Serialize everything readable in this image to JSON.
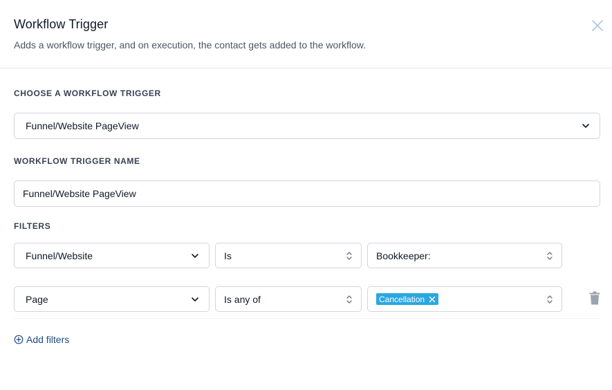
{
  "modal": {
    "title": "Workflow Trigger",
    "subtitle": "Adds a workflow trigger, and on execution, the contact gets added to the workflow.",
    "close_icon": "close-icon"
  },
  "trigger": {
    "label": "CHOOSE A WORKFLOW TRIGGER",
    "selected": "Funnel/Website PageView"
  },
  "trigger_name": {
    "label": "WORKFLOW TRIGGER NAME",
    "value": "Funnel/Website PageView"
  },
  "filters": {
    "label": "FILTERS",
    "rows": [
      {
        "field": "Funnel/Website",
        "operator": "Is",
        "value": "Bookkeeper:"
      },
      {
        "field": "Page",
        "operator": "Is any of",
        "tags": [
          "Cancellation"
        ]
      }
    ],
    "add_label": "Add filters"
  },
  "colors": {
    "accent": "#2ba7e0",
    "link": "#1f4b80",
    "border": "#d1d5db"
  }
}
